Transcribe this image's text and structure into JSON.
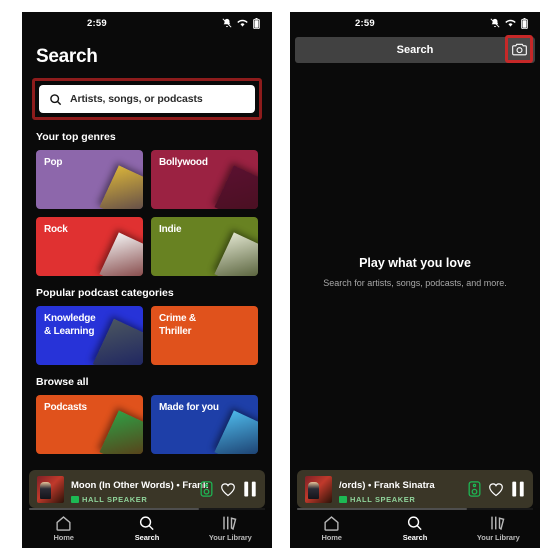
{
  "status_bar": {
    "time": "2:59",
    "icons": [
      "alarm-muted-icon",
      "wifi-icon",
      "battery-icon"
    ]
  },
  "left_panel": {
    "page_title": "Search",
    "search": {
      "placeholder": "Artists, songs, or podcasts",
      "icon": "search-icon",
      "highlighted": true
    },
    "sections": [
      {
        "title": "Your top genres",
        "cards": [
          {
            "label": "Pop",
            "color": "#8d67ab",
            "thumb": "#d8b33a"
          },
          {
            "label": "Bollywood",
            "color": "#9b2242",
            "thumb": "#5a1030"
          },
          {
            "label": "Rock",
            "color": "#e03131",
            "thumb": "#f2f2f2"
          },
          {
            "label": "Indie",
            "color": "#688222",
            "thumb": "#dfe3cd"
          }
        ]
      },
      {
        "title": "Popular podcast categories",
        "cards": [
          {
            "label": "Knowledge & Learning",
            "color": "#2733d8",
            "thumb": "#4a5560"
          },
          {
            "label": "Crime & Thriller",
            "color": "#e0521c",
            "thumb": "#e0521c"
          }
        ]
      },
      {
        "title": "Browse all",
        "cards": [
          {
            "label": "Podcasts",
            "color": "#e0521c",
            "thumb": "#2f9e44"
          },
          {
            "label": "Made for you",
            "color": "#1e3fa8",
            "thumb": "#4db7e8"
          }
        ]
      }
    ],
    "player": {
      "track": "Moon (In Other Words) • Frank",
      "device": "HALL SPEAKER",
      "device_icon": "speaker-chip-icon",
      "connect_icon": "speaker-icon",
      "like_icon": "heart-icon",
      "play_icon": "pause-icon",
      "progress_percent": 72
    }
  },
  "right_panel": {
    "header": {
      "title": "Search",
      "camera_icon": "camera-icon",
      "camera_highlighted": true
    },
    "hero": {
      "title": "Play what you love",
      "subtitle": "Search for artists, songs, podcasts, and more."
    },
    "player": {
      "track": "/ords) • Frank Sinatra",
      "device": "HALL SPEAKER",
      "device_icon": "speaker-chip-icon",
      "connect_icon": "speaker-icon",
      "like_icon": "heart-icon",
      "play_icon": "pause-icon",
      "progress_percent": 72
    }
  },
  "nav": {
    "items": [
      {
        "label": "Home",
        "icon": "home-icon",
        "active": false
      },
      {
        "label": "Search",
        "icon": "search-icon",
        "active": true
      },
      {
        "label": "Your Library",
        "icon": "library-icon",
        "active": false
      }
    ]
  },
  "colors": {
    "page_background": "#ffffff",
    "phone_background": "#0a0a0a",
    "highlight_red": "#8e1c1c",
    "highlight_red_bright": "#c62828",
    "accent_green": "#1db954",
    "player_background": "#3a3627",
    "header_gray": "#414141"
  }
}
